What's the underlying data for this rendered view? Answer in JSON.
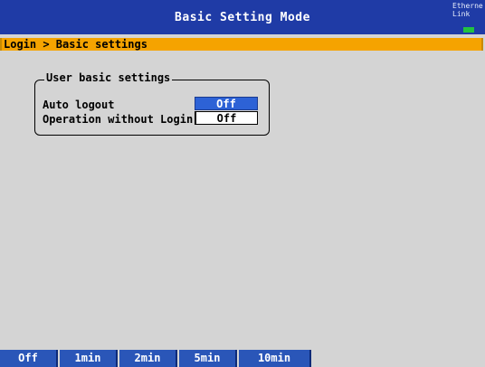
{
  "window": {
    "title": "Basic Setting Mode",
    "network": {
      "label_line1": "Etherne",
      "label_line2": "Link",
      "status_color": "#21c240"
    }
  },
  "breadcrumb": "Login > Basic settings",
  "panel": {
    "title": "User basic settings",
    "rows": [
      {
        "label": "Auto logout",
        "value": "Off",
        "selected": true
      },
      {
        "label": "Operation without Login",
        "value": "Off",
        "selected": false
      }
    ]
  },
  "softkeys": [
    "Off",
    "1min",
    "2min",
    "5min",
    "10min"
  ],
  "colors": {
    "titlebar": "#1f3ba6",
    "breadcrumb": "#f5a300",
    "selection": "#2d62d6",
    "softkey": "#2a56b8"
  }
}
